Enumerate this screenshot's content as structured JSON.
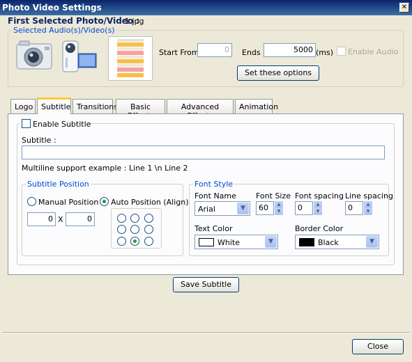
{
  "window": {
    "title": "Photo Video Settings",
    "close_glyph": "✕"
  },
  "header": {
    "first_selected_label": "First Selected Photo/Video :",
    "first_selected_value": "1.jpg"
  },
  "media_group": {
    "legend": "Selected Audio(s)/Video(s)",
    "start_from_label": "Start From :",
    "start_from_value": "0",
    "ends_label": "Ends :",
    "ends_value": "5000",
    "ms_label": "(ms)",
    "enable_audio_label": "Enable Audio",
    "set_options_label": "Set these options",
    "icons": [
      "camera-icon",
      "camcorder-icon",
      "document-thumbnail-icon"
    ]
  },
  "tabs": [
    {
      "label": "Logo",
      "active": false
    },
    {
      "label": "Subtitle",
      "active": true
    },
    {
      "label": "Transitions",
      "active": false
    },
    {
      "label": "Basic Effects",
      "active": false
    },
    {
      "label": "Advanced Effects",
      "active": false
    },
    {
      "label": "Animation",
      "active": false
    }
  ],
  "subtitle": {
    "enable_label": "Enable Subtitle",
    "subtitle_label": "Subtitle :",
    "subtitle_value": "",
    "multiline_hint": "Multiline support example : Line 1 \\n Line 2",
    "position": {
      "legend": "Subtitle Position",
      "manual_label": "Manual Position",
      "auto_label": "Auto Position (Align)",
      "x_value": "0",
      "x_sep": "X",
      "y_value": "0",
      "align_selected": "bottom-center"
    },
    "font": {
      "legend": "Font Style",
      "name_label": "Font Name",
      "name_value": "Arial",
      "size_label": "Font Size",
      "size_value": "60",
      "spacing_label": "Font spacing",
      "spacing_value": "0",
      "line_spacing_label": "Line spacing",
      "line_spacing_value": "0",
      "text_color_label": "Text Color",
      "text_color_value": "White",
      "text_color_swatch": "#ffffff",
      "border_color_label": "Border Color",
      "border_color_value": "Black",
      "border_color_swatch": "#000000"
    },
    "save_label": "Save Subtitle"
  },
  "footer": {
    "close_label": "Close"
  }
}
